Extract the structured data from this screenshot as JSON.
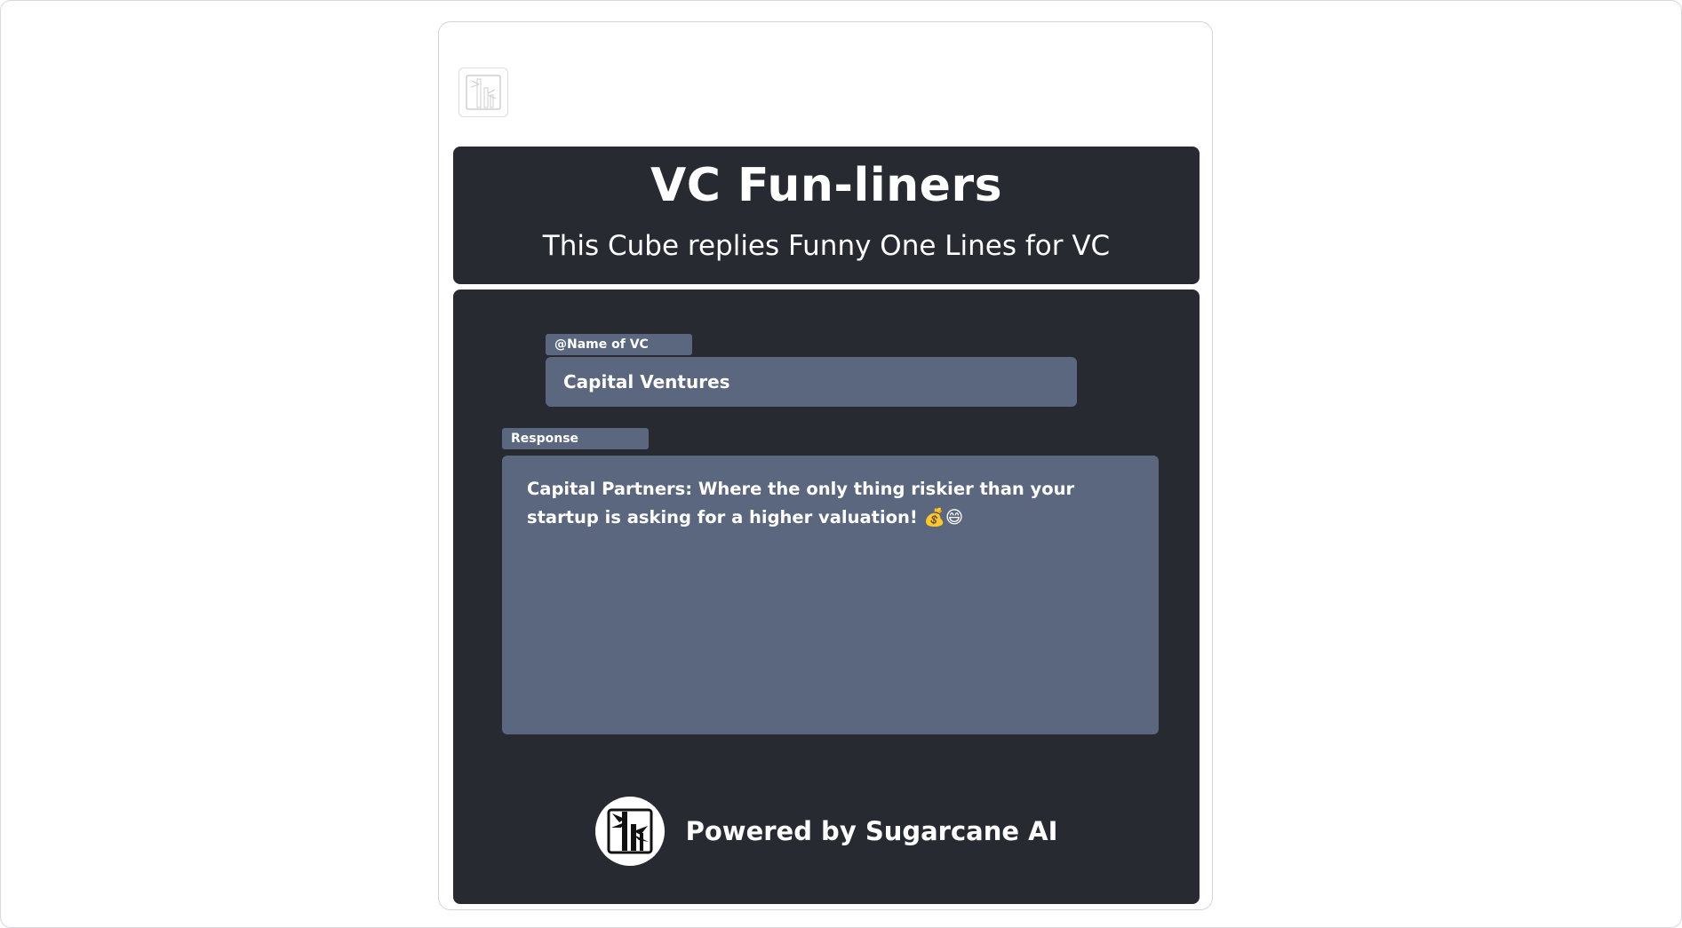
{
  "header": {
    "title": "VC Fun-liners",
    "subtitle": "This Cube replies Funny One Lines for VC"
  },
  "form": {
    "name_label": "@Name of VC",
    "name_value": "Capital Ventures"
  },
  "response": {
    "label": "Response",
    "text": "Capital Partners: Where the only thing riskier than your startup is asking for a higher valuation! 💰😄"
  },
  "footer": {
    "powered_by": "Powered by Sugarcane AI",
    "logo_icon": "sugarcane-logo-icon"
  },
  "colors": {
    "panel_bg": "#272a31",
    "field_bg": "#5a677e",
    "text": "#ffffff"
  }
}
